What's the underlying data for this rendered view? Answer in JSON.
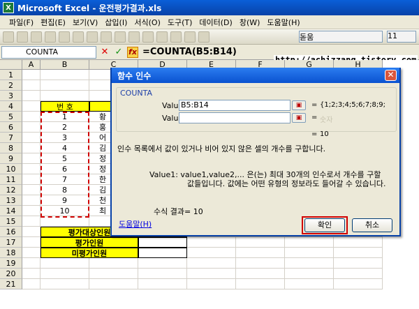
{
  "window": {
    "app_icon": "X",
    "title": "Microsoft Excel - 운전평가결과.xls"
  },
  "menu": [
    "파일(F)",
    "편집(E)",
    "보기(V)",
    "삽입(I)",
    "서식(O)",
    "도구(T)",
    "데이터(D)",
    "창(W)",
    "도움말(H)"
  ],
  "toolbar": {
    "font_name": "돋움",
    "font_size": "11"
  },
  "formula_bar": {
    "name_box": "COUNTA",
    "cancel_icon": "✕",
    "enter_icon": "✓",
    "fx_label": "fx",
    "formula": "=COUNTA(B5:B14)"
  },
  "overlay_url": "http://achizzang.tistory.com",
  "sheet": {
    "columns": [
      "A",
      "B",
      "C",
      "D",
      "E",
      "F",
      "G",
      "H"
    ],
    "rows": [
      "1",
      "2",
      "3",
      "4",
      "5",
      "6",
      "7",
      "8",
      "9",
      "10",
      "11",
      "12",
      "13",
      "14",
      "15",
      "16",
      "17",
      "18",
      "19",
      "20",
      "21"
    ],
    "header_b": "번 호",
    "header_c": "이",
    "numbers": [
      "1",
      "2",
      "3",
      "4",
      "5",
      "6",
      "7",
      "8",
      "9",
      "10"
    ],
    "names": [
      "황",
      "홍",
      "어",
      "김",
      "정",
      "정",
      "한",
      "김",
      "천",
      "최"
    ],
    "summary_labels": [
      "평가대상인원",
      "평가인원",
      "미평가인원"
    ],
    "summary_d16": "B5:B14)"
  },
  "dialog": {
    "title": "함수 인수",
    "close_icon": "✕",
    "function_name": "COUNTA",
    "value1_label": "Value1",
    "value1_input": "B5:B14",
    "value1_result": "{1;2;3;4;5;6;7;8;9;",
    "value2_label": "Value2",
    "value2_input": "",
    "value2_result": "숫자",
    "equals": "=",
    "equals_result": "10",
    "description": "인수 목록에서 값이 있거나 비어 있지 않은 셀의 개수를 구합니다.",
    "arg_desc_line1": "Value1: value1,value2,...  은(는) 최대 30개의 인수로서 개수를 구할",
    "arg_desc_line2": "값들입니다. 값에는 어떤 유형의 정보라도 들어갈 수 있습니다.",
    "result_line": "수식 결과= 10",
    "help_link": "도움말(H)",
    "ok_label": "확인",
    "cancel_label": "취소"
  }
}
